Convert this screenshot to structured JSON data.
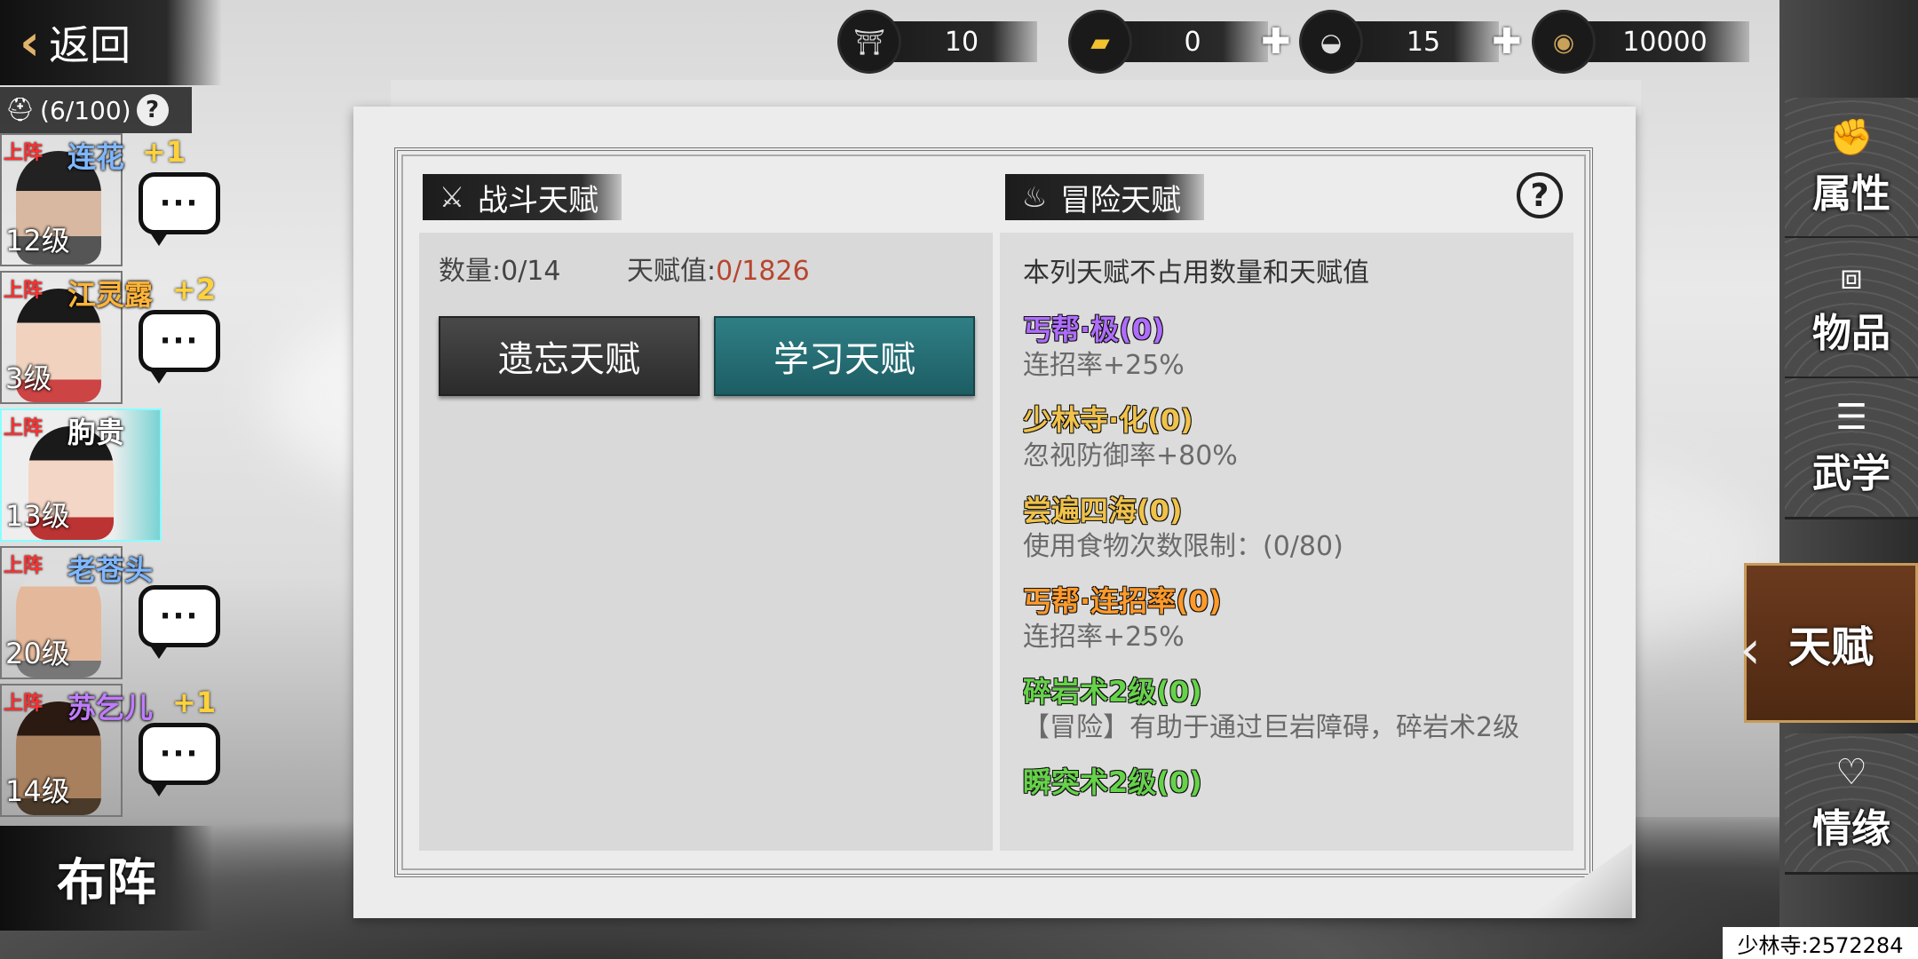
{
  "top": {
    "back_label": "返回",
    "currencies": [
      {
        "icon": "bronze-token-icon",
        "value": "10",
        "plus": false
      },
      {
        "icon": "gold-ingot-icon",
        "value": "0",
        "plus": true
      },
      {
        "icon": "silver-ingot-icon",
        "value": "15",
        "plus": true
      },
      {
        "icon": "copper-coin-icon",
        "value": "10000",
        "plus": false
      }
    ]
  },
  "roster": {
    "count": "(6/100)",
    "help": "?",
    "heroes": [
      {
        "tag": "上阵",
        "name": "连花",
        "bonus": "+1",
        "level": "12级",
        "name_color": "#7fb7ff",
        "chat": "···"
      },
      {
        "tag": "上阵",
        "name": "江灵露",
        "bonus": "+2",
        "level": "3级",
        "name_color": "#ffb43a",
        "chat": "···"
      },
      {
        "tag": "上阵",
        "name": "朐贵",
        "bonus": "",
        "level": "13级",
        "name_color": "#f0f0f0",
        "chat": ""
      },
      {
        "tag": "上阵",
        "name": "老苍头",
        "bonus": "",
        "level": "20级",
        "name_color": "#7fb7ff",
        "chat": "···"
      },
      {
        "tag": "上阵",
        "name": "苏乞儿",
        "bonus": "+1",
        "level": "14级",
        "name_color": "#c07cff",
        "chat": "···"
      }
    ],
    "formation": "布阵"
  },
  "panel": {
    "combat_title": "战斗天赋",
    "adventure_title": "冒险天赋",
    "count_label": "数量:0/14",
    "points_prefix": "天赋值:",
    "points_value": "0/1826",
    "forget_label": "遗忘天赋",
    "learn_label": "学习天赋",
    "help": "?",
    "note": "本列天赋不占用数量和天赋值",
    "talents": [
      {
        "name": "丐帮·极(0)",
        "desc": "连招率+25%",
        "color": "#b06cff"
      },
      {
        "name": "少林寺·化(0)",
        "desc": "忽视防御率+80%",
        "color": "#f0c24a"
      },
      {
        "name": "尝遍四海(0)",
        "desc": "使用食物次数限制：(0/80)",
        "color": "#f0c24a"
      },
      {
        "name": "丐帮·连招率(0)",
        "desc": "连招率+25%",
        "color": "#ff9a2a"
      },
      {
        "name": "碎岩术2级(0)",
        "desc": "【冒险】有助于通过巨岩障碍，碎岩术2级",
        "color": "#66d24a"
      },
      {
        "name": "瞬突术2级(0)",
        "desc": "",
        "color": "#66d24a"
      }
    ]
  },
  "nav": {
    "items": [
      "属性",
      "物品",
      "武学",
      "天赋",
      "情缘"
    ],
    "active": "天赋"
  },
  "footer": "少林寺:2572284"
}
